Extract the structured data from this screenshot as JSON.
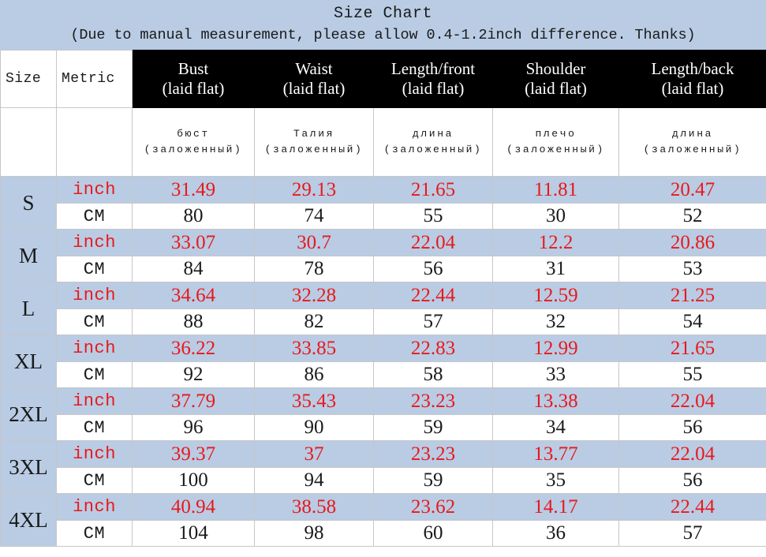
{
  "title": {
    "main": "Size Chart",
    "note": "(Due to manual measurement, please allow 0.4-1.2inch difference. Thanks)"
  },
  "colors": {
    "band_blue": "#b9cce4",
    "header_black": "#000000",
    "inch_red": "#e8191b",
    "text_black": "#1a1a1a",
    "grid": "#c7c7c7"
  },
  "header": {
    "size_label": "Size",
    "metric_label": "Metric",
    "columns": [
      {
        "line1": "Bust",
        "line2": "(laid flat)",
        "ru_word": "бюст",
        "ru_paren": "(заложенный)"
      },
      {
        "line1": "Waist",
        "line2": "(laid flat)",
        "ru_word": "Талия",
        "ru_paren": "(заложенный)"
      },
      {
        "line1": "Length/front",
        "line2": "(laid flat)",
        "ru_word": "длина",
        "ru_paren": "(заложенный)"
      },
      {
        "line1": "Shoulder",
        "line2": "(laid flat)",
        "ru_word": "плечо",
        "ru_paren": "(заложенный)"
      },
      {
        "line1": "Length/back",
        "line2": "(laid flat)",
        "ru_word": "длина",
        "ru_paren": "(заложенный)"
      }
    ]
  },
  "metric_labels": {
    "inch": "inch",
    "cm": "CM"
  },
  "rows": [
    {
      "size": "S",
      "inch": {
        "bust": "31.49",
        "waist": "29.13",
        "length_front": "21.65",
        "shoulder": "11.81",
        "length_back": "20.47"
      },
      "cm": {
        "bust": "80",
        "waist": "74",
        "length_front": "55",
        "shoulder": "30",
        "length_back": "52"
      }
    },
    {
      "size": "M",
      "inch": {
        "bust": "33.07",
        "waist": "30.7",
        "length_front": "22.04",
        "shoulder": "12.2",
        "length_back": "20.86"
      },
      "cm": {
        "bust": "84",
        "waist": "78",
        "length_front": "56",
        "shoulder": "31",
        "length_back": "53"
      }
    },
    {
      "size": "L",
      "inch": {
        "bust": "34.64",
        "waist": "32.28",
        "length_front": "22.44",
        "shoulder": "12.59",
        "length_back": "21.25"
      },
      "cm": {
        "bust": "88",
        "waist": "82",
        "length_front": "57",
        "shoulder": "32",
        "length_back": "54"
      }
    },
    {
      "size": "XL",
      "inch": {
        "bust": "36.22",
        "waist": "33.85",
        "length_front": "22.83",
        "shoulder": "12.99",
        "length_back": "21.65"
      },
      "cm": {
        "bust": "92",
        "waist": "86",
        "length_front": "58",
        "shoulder": "33",
        "length_back": "55"
      }
    },
    {
      "size": "2XL",
      "inch": {
        "bust": "37.79",
        "waist": "35.43",
        "length_front": "23.23",
        "shoulder": "13.38",
        "length_back": "22.04"
      },
      "cm": {
        "bust": "96",
        "waist": "90",
        "length_front": "59",
        "shoulder": "34",
        "length_back": "56"
      }
    },
    {
      "size": "3XL",
      "inch": {
        "bust": "39.37",
        "waist": "37",
        "length_front": "23.23",
        "shoulder": "13.77",
        "length_back": "22.04"
      },
      "cm": {
        "bust": "100",
        "waist": "94",
        "length_front": "59",
        "shoulder": "35",
        "length_back": "56"
      }
    },
    {
      "size": "4XL",
      "inch": {
        "bust": "40.94",
        "waist": "38.58",
        "length_front": "23.62",
        "shoulder": "14.17",
        "length_back": "22.44"
      },
      "cm": {
        "bust": "104",
        "waist": "98",
        "length_front": "60",
        "shoulder": "36",
        "length_back": "57"
      }
    }
  ]
}
